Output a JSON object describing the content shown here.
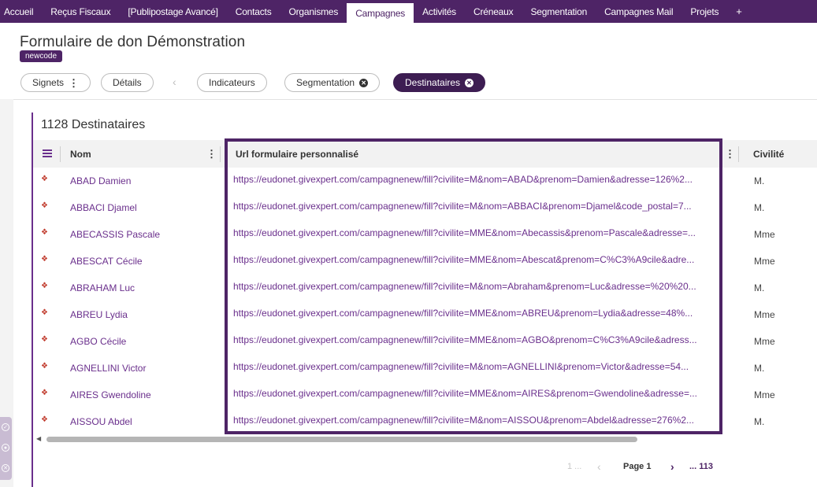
{
  "nav": {
    "items": [
      "Accueil",
      "Reçus Fiscaux",
      "[Publipostage Avancé]",
      "Contacts",
      "Organismes",
      "Campagnes",
      "Activités",
      "Créneaux",
      "Segmentation",
      "Campagnes Mail",
      "Projets",
      "+"
    ],
    "active": "Campagnes"
  },
  "header": {
    "title": "Formulaire de don Démonstration",
    "tag": "newcode"
  },
  "tabs": {
    "signets": "Signets",
    "details": "Détails",
    "indicateurs": "Indicateurs",
    "segmentation": "Segmentation",
    "destinataires": "Destinataires"
  },
  "panel": {
    "title": "1128 Destinataires",
    "columns": {
      "nom": "Nom",
      "url": "Url formulaire personnalisé",
      "civilite": "Civilité"
    },
    "rows": [
      {
        "nom": "ABAD Damien",
        "url": "https://eudonet.givexpert.com/campagnenew/fill?civilite=M&nom=ABAD&prenom=Damien&adresse=126%2...",
        "civ": "M."
      },
      {
        "nom": "ABBACI Djamel",
        "url": "https://eudonet.givexpert.com/campagnenew/fill?civilite=M&nom=ABBACI&prenom=Djamel&code_postal=7...",
        "civ": "M."
      },
      {
        "nom": "ABECASSIS Pascale",
        "url": "https://eudonet.givexpert.com/campagnenew/fill?civilite=MME&nom=Abecassis&prenom=Pascale&adresse=...",
        "civ": "Mme"
      },
      {
        "nom": "ABESCAT Cécile",
        "url": "https://eudonet.givexpert.com/campagnenew/fill?civilite=MME&nom=Abescat&prenom=C%C3%A9cile&adre...",
        "civ": "Mme"
      },
      {
        "nom": "ABRAHAM Luc",
        "url": "https://eudonet.givexpert.com/campagnenew/fill?civilite=M&nom=Abraham&prenom=Luc&adresse=%20%20...",
        "civ": "M."
      },
      {
        "nom": "ABREU Lydia",
        "url": "https://eudonet.givexpert.com/campagnenew/fill?civilite=MME&nom=ABREU&prenom=Lydia&adresse=48%...",
        "civ": "Mme"
      },
      {
        "nom": "AGBO Cécile",
        "url": "https://eudonet.givexpert.com/campagnenew/fill?civilite=MME&nom=AGBO&prenom=C%C3%A9cile&adress...",
        "civ": "Mme"
      },
      {
        "nom": "AGNELLINI Victor",
        "url": "https://eudonet.givexpert.com/campagnenew/fill?civilite=M&nom=AGNELLINI&prenom=Victor&adresse=54...",
        "civ": "M."
      },
      {
        "nom": "AIRES Gwendoline",
        "url": "https://eudonet.givexpert.com/campagnenew/fill?civilite=MME&nom=AIRES&prenom=Gwendoline&adresse=...",
        "civ": "Mme"
      },
      {
        "nom": "AISSOU Abdel",
        "url": "https://eudonet.givexpert.com/campagnenew/fill?civilite=M&nom=AISSOU&prenom=Abdel&adresse=276%2...",
        "civ": "M."
      }
    ]
  },
  "pager": {
    "first": "1 ...",
    "current": "Page 1",
    "last": "... 113"
  }
}
